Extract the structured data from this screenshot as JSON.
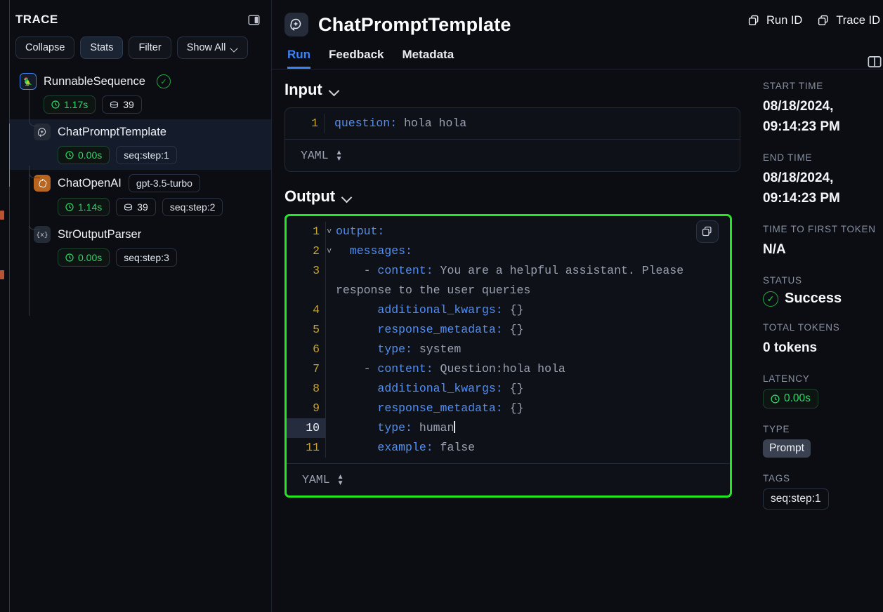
{
  "trace": {
    "title": "TRACE",
    "panel_toggle_icon": "panel-toggle-icon",
    "toolbar": {
      "collapse": "Collapse",
      "stats": "Stats",
      "filter": "Filter",
      "show_all": "Show All"
    },
    "nodes": [
      {
        "name": "RunnableSequence",
        "icon": "parrot-icon",
        "status_icon": "check-circle-icon",
        "latency": "1.17s",
        "tokens": "39",
        "model": null,
        "step": null,
        "selected": false
      },
      {
        "name": "ChatPromptTemplate",
        "icon": "chat-prompt-icon",
        "status_icon": null,
        "latency": "0.00s",
        "tokens": null,
        "model": null,
        "step": "seq:step:1",
        "selected": true
      },
      {
        "name": "ChatOpenAI",
        "icon": "openai-icon",
        "status_icon": null,
        "latency": "1.14s",
        "tokens": "39",
        "model": "gpt-3.5-turbo",
        "step": "seq:step:2",
        "selected": false
      },
      {
        "name": "StrOutputParser",
        "icon": "parser-icon",
        "status_icon": null,
        "latency": "0.00s",
        "tokens": null,
        "model": null,
        "step": "seq:step:3",
        "selected": false
      }
    ]
  },
  "header": {
    "icon": "chat-prompt-icon",
    "title": "ChatPromptTemplate",
    "tabs": [
      {
        "label": "Run",
        "active": true
      },
      {
        "label": "Feedback",
        "active": false
      },
      {
        "label": "Metadata",
        "active": false
      }
    ],
    "run_id_label": "Run ID",
    "trace_id_label": "Trace ID",
    "copy_icon": "copy-icon",
    "panel_toggle_icon": "panel-toggle-icon"
  },
  "input": {
    "title": "Input",
    "line_number": "1",
    "key": "question:",
    "value": "hola hola",
    "format": "YAML"
  },
  "output": {
    "title": "Output",
    "format": "YAML",
    "copy_icon": "copy-icon",
    "lines": [
      {
        "n": "1",
        "fold": "v",
        "indent": 0,
        "dash": false,
        "key": "output:",
        "value": "",
        "hl": false
      },
      {
        "n": "2",
        "fold": "v",
        "indent": 1,
        "dash": false,
        "key": "messages:",
        "value": "",
        "hl": false
      },
      {
        "n": "3",
        "fold": "",
        "indent": 2,
        "dash": true,
        "key": "content:",
        "value": "You are a helpful assistant. Please response to the user queries",
        "hl": false
      },
      {
        "n": "4",
        "fold": "",
        "indent": 3,
        "dash": false,
        "key": "additional_kwargs:",
        "value": "{}",
        "hl": false
      },
      {
        "n": "5",
        "fold": "",
        "indent": 3,
        "dash": false,
        "key": "response_metadata:",
        "value": "{}",
        "hl": false
      },
      {
        "n": "6",
        "fold": "",
        "indent": 3,
        "dash": false,
        "key": "type:",
        "value": "system",
        "hl": false
      },
      {
        "n": "7",
        "fold": "",
        "indent": 2,
        "dash": true,
        "key": "content:",
        "value": "Question:hola hola",
        "hl": false
      },
      {
        "n": "8",
        "fold": "",
        "indent": 3,
        "dash": false,
        "key": "additional_kwargs:",
        "value": "{}",
        "hl": false
      },
      {
        "n": "9",
        "fold": "",
        "indent": 3,
        "dash": false,
        "key": "response_metadata:",
        "value": "{}",
        "hl": false
      },
      {
        "n": "10",
        "fold": "",
        "indent": 3,
        "dash": false,
        "key": "type:",
        "value": "human",
        "hl": true,
        "cursor": true
      },
      {
        "n": "11",
        "fold": "",
        "indent": 3,
        "dash": false,
        "key": "example:",
        "value": "false",
        "hl": false
      }
    ]
  },
  "meta": {
    "start_time_label": "START TIME",
    "start_time_value_1": "08/18/2024,",
    "start_time_value_2": "09:14:23 PM",
    "end_time_label": "END TIME",
    "end_time_value_1": "08/18/2024,",
    "end_time_value_2": "09:14:23 PM",
    "ttft_label": "TIME TO FIRST TOKEN",
    "ttft_value": "N/A",
    "status_label": "STATUS",
    "status_value": "Success",
    "status_icon": "check-circle-icon",
    "total_tokens_label": "TOTAL TOKENS",
    "total_tokens_value": "0 tokens",
    "latency_label": "LATENCY",
    "latency_value": "0.00s",
    "type_label": "TYPE",
    "type_value": "Prompt",
    "tags_label": "TAGS",
    "tags_value": "seq:step:1"
  },
  "colors": {
    "accent_blue": "#3b82f6",
    "success_green": "#2bd968",
    "highlight_border": "#22e822",
    "background": "#0b0d12",
    "key_blue": "#4f8ff7"
  }
}
